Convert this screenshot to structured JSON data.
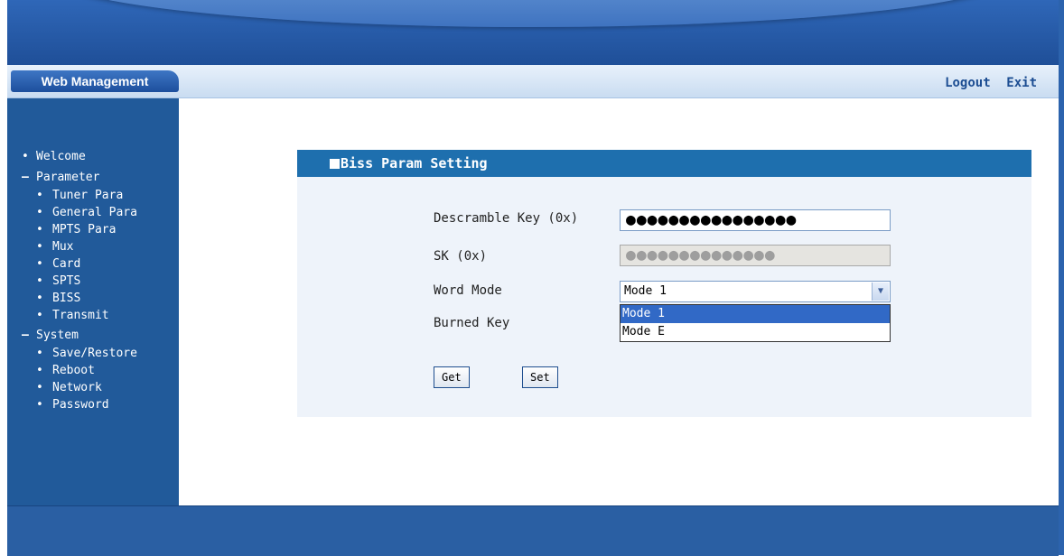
{
  "header": {
    "brand": "Web Management",
    "links": [
      "Logout",
      "Exit"
    ]
  },
  "sidebar": {
    "items": [
      {
        "label": "Welcome",
        "level": 1,
        "marker": "bullet"
      },
      {
        "label": "Parameter",
        "level": 1,
        "marker": "minus"
      },
      {
        "label": "Tuner Para",
        "level": 2
      },
      {
        "label": "General Para",
        "level": 2
      },
      {
        "label": "MPTS Para",
        "level": 2
      },
      {
        "label": "Mux",
        "level": 2
      },
      {
        "label": "Card",
        "level": 2
      },
      {
        "label": "SPTS",
        "level": 2
      },
      {
        "label": "BISS",
        "level": 2
      },
      {
        "label": "Transmit",
        "level": 2
      },
      {
        "label": "System",
        "level": 1,
        "marker": "minus"
      },
      {
        "label": "Save/Restore",
        "level": 2
      },
      {
        "label": "Reboot",
        "level": 2
      },
      {
        "label": "Network",
        "level": 2
      },
      {
        "label": "Password",
        "level": 2
      }
    ]
  },
  "panel": {
    "title": "Biss Param Setting",
    "descramble_label": "Descramble Key (0x)",
    "descramble_value": "●●●●●●●●●●●●●●●●",
    "sk_label": "SK (0x)",
    "sk_value": "●●●●●●●●●●●●●●",
    "word_mode_label": "Word Mode",
    "word_mode_value": "Mode 1",
    "word_mode_options": [
      "Mode 1",
      "Mode E"
    ],
    "burned_key_label": "Burned Key",
    "get_label": "Get",
    "set_label": "Set"
  }
}
